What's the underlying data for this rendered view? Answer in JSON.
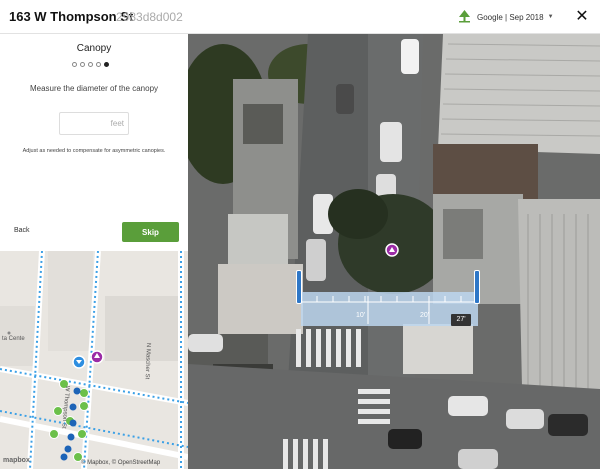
{
  "header": {
    "address": "163 W Thompson St",
    "tree_id": "2983d8d002",
    "imagery_source": "Google | Sep 2018",
    "close_label": "✕"
  },
  "panel": {
    "title": "Canopy",
    "steps_total": 5,
    "step_current": 5,
    "instruction": "Measure the diameter of the canopy",
    "input_value": "",
    "input_placeholder": "feet",
    "hint": "Adjust as needed to compensate for asymmetric canopies.",
    "back_label": "Back",
    "skip_label": "Skip"
  },
  "minimap": {
    "street_labels": [
      "N Mascher St",
      "W Thompson St",
      "ta Cente"
    ],
    "attribution": "© Mapbox, © OpenStreetMap",
    "logo": "mapbox"
  },
  "ruler": {
    "tick_labels": [
      "10'",
      "20'"
    ],
    "measurement": "27'"
  },
  "colors": {
    "accent_green": "#5a9e3a",
    "handle_blue": "#2e77c7",
    "marker_purple": "#9b2ba6",
    "ruler_fill": "#bcd6ee"
  }
}
